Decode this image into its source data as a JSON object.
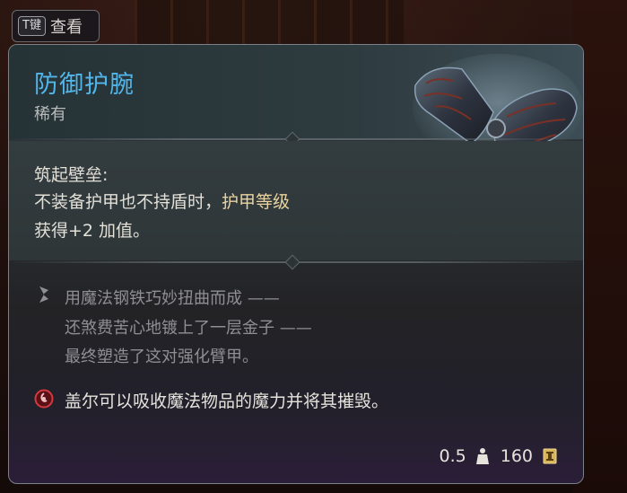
{
  "key_hint": {
    "key": "T键",
    "label": "查看"
  },
  "item": {
    "name": "防御护腕",
    "rarity": "稀有",
    "feature": {
      "title": "筑起壁垒:",
      "line1_a": "不装备护甲也不持盾时，",
      "line1_b": "护甲等级",
      "line2": "获得+2 加值。"
    },
    "flavor": [
      "用魔法钢铁巧妙扭曲而成 ——",
      "还煞费苦心地镀上了一层金子 ——",
      "最终塑造了这对强化臂甲。"
    ],
    "warning": "盖尔可以吸收魔法物品的魔力并将其摧毁。",
    "weight": "0.5",
    "value": "160"
  },
  "colors": {
    "name": "#52b6ea",
    "highlight": "#e9d3a0",
    "border": "#79818a"
  },
  "icons": {
    "art": "bracers-art",
    "flavor": "quill-icon",
    "warning": "absorb-warning-icon",
    "weight": "weight-icon",
    "gold": "gold-coin-icon"
  }
}
